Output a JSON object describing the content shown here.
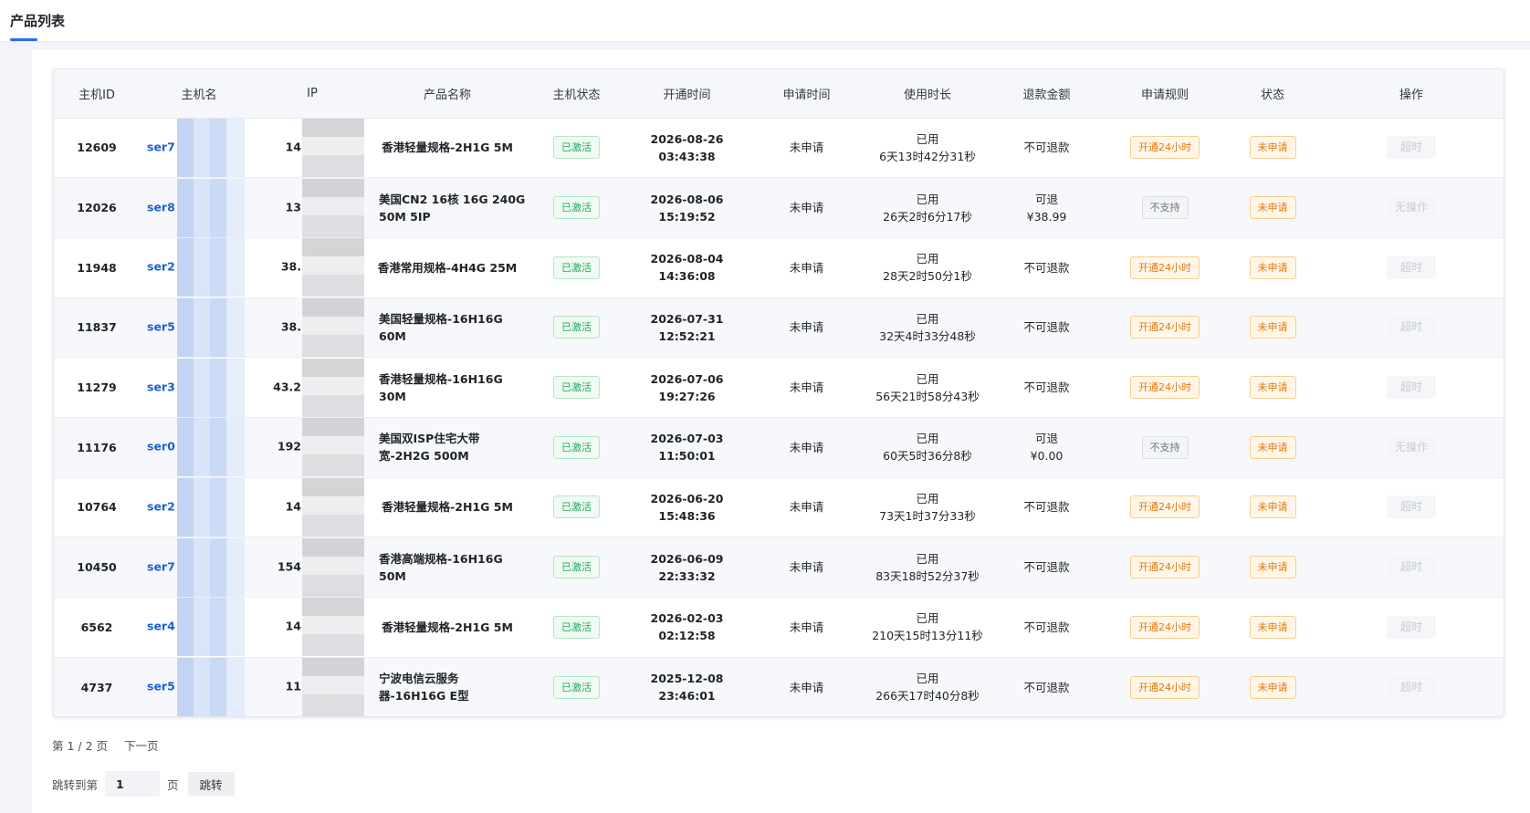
{
  "page": {
    "tab_label": "产品列表"
  },
  "table": {
    "headers": [
      "主机ID",
      "主机名",
      "IP",
      "产品名称",
      "主机状态",
      "开通时间",
      "申请时间",
      "使用时长",
      "退款金额",
      "申请规则",
      "状态",
      "操作"
    ],
    "rows": [
      {
        "id": "12609",
        "host": "ser7",
        "ip": "14",
        "product": [
          "香港轻量规格-2H1G 5M"
        ],
        "status": "已激活",
        "open_date": "2026-08-26",
        "open_time": "03:43:38",
        "apply_time": "未申请",
        "usage_1": "已用",
        "usage_2": "6天13时42分31秒",
        "refund_1": "不可退款",
        "refund_2": "",
        "rule": "开通24小时",
        "rule_type": "orange",
        "state": "未申请",
        "op": "超时"
      },
      {
        "id": "12026",
        "host": "ser8",
        "ip": "13",
        "product": [
          "美国CN2 16核 16G 240G",
          "50M 5IP"
        ],
        "status": "已激活",
        "open_date": "2026-08-06",
        "open_time": "15:19:52",
        "apply_time": "未申请",
        "usage_1": "已用",
        "usage_2": "26天2时6分17秒",
        "refund_1": "可退",
        "refund_2": "¥38.99",
        "rule": "不支持",
        "rule_type": "gray",
        "state": "未申请",
        "op": "无操作"
      },
      {
        "id": "11948",
        "host": "ser2",
        "ip": "38.",
        "product": [
          "香港常用规格-4H4G 25M"
        ],
        "status": "已激活",
        "open_date": "2026-08-04",
        "open_time": "14:36:08",
        "apply_time": "未申请",
        "usage_1": "已用",
        "usage_2": "28天2时50分1秒",
        "refund_1": "不可退款",
        "refund_2": "",
        "rule": "开通24小时",
        "rule_type": "orange",
        "state": "未申请",
        "op": "超时"
      },
      {
        "id": "11837",
        "host": "ser5",
        "ip": "38.",
        "product": [
          "美国轻量规格-16H16G",
          "60M"
        ],
        "status": "已激活",
        "open_date": "2026-07-31",
        "open_time": "12:52:21",
        "apply_time": "未申请",
        "usage_1": "已用",
        "usage_2": "32天4时33分48秒",
        "refund_1": "不可退款",
        "refund_2": "",
        "rule": "开通24小时",
        "rule_type": "orange",
        "state": "未申请",
        "op": "超时"
      },
      {
        "id": "11279",
        "host": "ser3",
        "ip": "43.2",
        "product": [
          "香港轻量规格-16H16G",
          "30M"
        ],
        "status": "已激活",
        "open_date": "2026-07-06",
        "open_time": "19:27:26",
        "apply_time": "未申请",
        "usage_1": "已用",
        "usage_2": "56天21时58分43秒",
        "refund_1": "不可退款",
        "refund_2": "",
        "rule": "开通24小时",
        "rule_type": "orange",
        "state": "未申请",
        "op": "超时"
      },
      {
        "id": "11176",
        "host": "ser0",
        "ip": "192",
        "product": [
          "美国双ISP住宅大带",
          "宽-2H2G 500M"
        ],
        "status": "已激活",
        "open_date": "2026-07-03",
        "open_time": "11:50:01",
        "apply_time": "未申请",
        "usage_1": "已用",
        "usage_2": "60天5时36分8秒",
        "refund_1": "可退",
        "refund_2": "¥0.00",
        "rule": "不支持",
        "rule_type": "gray",
        "state": "未申请",
        "op": "无操作"
      },
      {
        "id": "10764",
        "host": "ser2",
        "ip": "14",
        "product": [
          "香港轻量规格-2H1G 5M"
        ],
        "status": "已激活",
        "open_date": "2026-06-20",
        "open_time": "15:48:36",
        "apply_time": "未申请",
        "usage_1": "已用",
        "usage_2": "73天1时37分33秒",
        "refund_1": "不可退款",
        "refund_2": "",
        "rule": "开通24小时",
        "rule_type": "orange",
        "state": "未申请",
        "op": "超时"
      },
      {
        "id": "10450",
        "host": "ser7",
        "ip": "154",
        "product": [
          "香港高端规格-16H16G",
          "50M"
        ],
        "status": "已激活",
        "open_date": "2026-06-09",
        "open_time": "22:33:32",
        "apply_time": "未申请",
        "usage_1": "已用",
        "usage_2": "83天18时52分37秒",
        "refund_1": "不可退款",
        "refund_2": "",
        "rule": "开通24小时",
        "rule_type": "orange",
        "state": "未申请",
        "op": "超时"
      },
      {
        "id": "6562",
        "host": "ser4",
        "ip": "14",
        "product": [
          "香港轻量规格-2H1G 5M"
        ],
        "status": "已激活",
        "open_date": "2026-02-03",
        "open_time": "02:12:58",
        "apply_time": "未申请",
        "usage_1": "已用",
        "usage_2": "210天15时13分11秒",
        "refund_1": "不可退款",
        "refund_2": "",
        "rule": "开通24小时",
        "rule_type": "orange",
        "state": "未申请",
        "op": "超时"
      },
      {
        "id": "4737",
        "host": "ser5",
        "ip": "11",
        "product": [
          "宁波电信云服务",
          "器-16H16G E型"
        ],
        "status": "已激活",
        "open_date": "2025-12-08",
        "open_time": "23:46:01",
        "apply_time": "未申请",
        "usage_1": "已用",
        "usage_2": "266天17时40分8秒",
        "refund_1": "不可退款",
        "refund_2": "",
        "rule": "开通24小时",
        "rule_type": "orange",
        "state": "未申请",
        "op": "超时"
      }
    ]
  },
  "pager": {
    "page_info": "第 1 / 2 页",
    "next": "下一页",
    "jump_label": "跳转到第",
    "jump_value": "1",
    "page_suffix": "页",
    "go": "跳转"
  },
  "colors": {
    "accent": "#2b6cf0",
    "green_tag": "#2aa860",
    "orange_tag": "#e07a10",
    "link": "#1a5fd6"
  }
}
